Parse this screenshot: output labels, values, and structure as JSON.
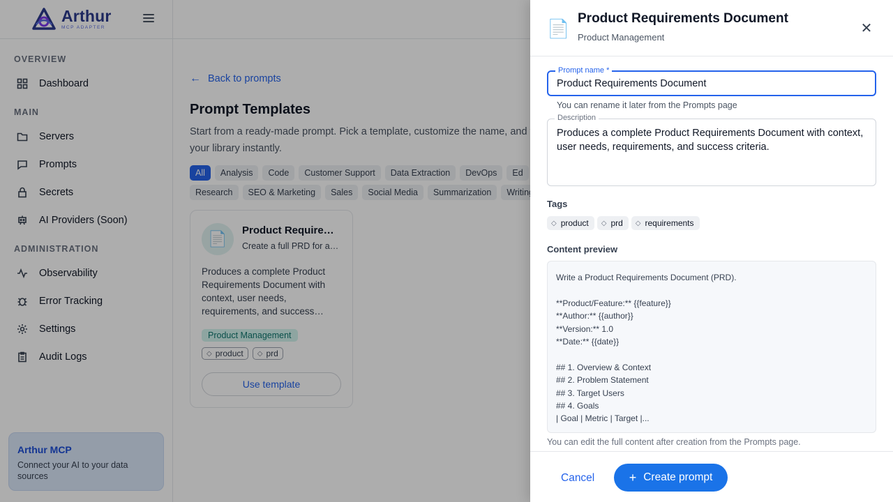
{
  "brand": {
    "name": "Arthur",
    "subtitle": "MCP ADAPTER",
    "logo_icon": "arthur-logo-icon"
  },
  "sidebar": {
    "sections": [
      {
        "title": "OVERVIEW",
        "items": [
          {
            "label": "Dashboard",
            "icon": "grid-icon"
          }
        ]
      },
      {
        "title": "MAIN",
        "items": [
          {
            "label": "Servers",
            "icon": "folder-icon"
          },
          {
            "label": "Prompts",
            "icon": "chat-icon"
          },
          {
            "label": "Secrets",
            "icon": "lock-icon"
          },
          {
            "label": "AI Providers (Soon)",
            "icon": "robot-icon"
          }
        ]
      },
      {
        "title": "ADMINISTRATION",
        "items": [
          {
            "label": "Observability",
            "icon": "activity-icon"
          },
          {
            "label": "Error Tracking",
            "icon": "bug-icon"
          },
          {
            "label": "Settings",
            "icon": "gear-icon"
          },
          {
            "label": "Audit Logs",
            "icon": "clipboard-icon"
          }
        ]
      }
    ],
    "promo": {
      "title": "Arthur MCP",
      "text": "Connect your AI to your data sources"
    }
  },
  "main": {
    "back_label": "Back to prompts",
    "title": "Prompt Templates",
    "subtitle": "Start from a ready-made prompt. Pick a template, customize the name, and to your library instantly.",
    "filters": [
      "All",
      "Analysis",
      "Code",
      "Customer Support",
      "Data Extraction",
      "DevOps",
      "Ed",
      "Research",
      "SEO & Marketing",
      "Sales",
      "Social Media",
      "Summarization",
      "Writing"
    ],
    "active_filter": "All",
    "card": {
      "title": "Product Require…",
      "subtitle": "Create a full PRD for a n…",
      "description": "Produces a complete Product Requirements Document with context, user needs, requirements, and success…",
      "category": "Product Management",
      "tags": [
        "product",
        "prd"
      ],
      "button": "Use template"
    }
  },
  "drawer": {
    "title": "Product Requirements Document",
    "subtitle": "Product Management",
    "name_label": "Prompt name *",
    "name_value": "Product Requirements Document",
    "name_helper": "You can rename it later from the Prompts page",
    "desc_label": "Description",
    "desc_value": "Produces a complete Product Requirements Document with context, user needs, requirements, and success criteria.",
    "tags_label": "Tags",
    "tags": [
      "product",
      "prd",
      "requirements"
    ],
    "preview_label": "Content preview",
    "preview_lines": [
      "Write a Product Requirements Document (PRD).",
      "",
      "**Product/Feature:** {{feature}}",
      "**Author:** {{author}}",
      "**Version:** 1.0",
      "**Date:** {{date}}",
      "",
      "## 1. Overview & Context",
      "## 2. Problem Statement",
      "## 3. Target Users",
      "## 4. Goals",
      "| Goal | Metric | Target |..."
    ],
    "footnote": "You can edit the full content after creation from the Prompts page.",
    "cancel_label": "Cancel",
    "create_label": "Create prompt"
  }
}
